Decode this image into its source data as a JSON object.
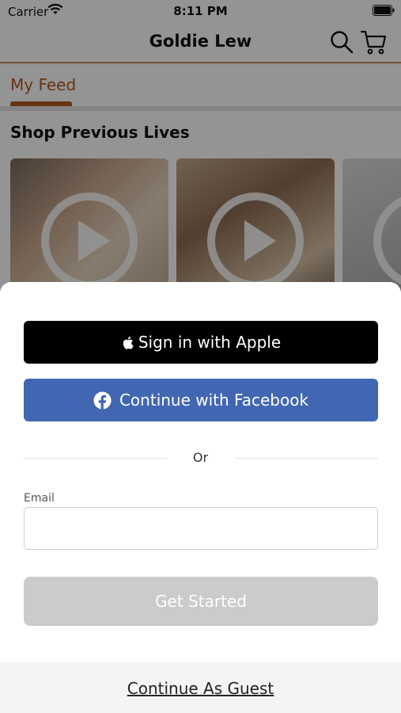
{
  "status_bar": {
    "carrier": "Carrier",
    "time": "8:11 PM"
  },
  "header": {
    "title": "Goldie Lew"
  },
  "tabs": [
    {
      "label": "My Feed",
      "active": true
    }
  ],
  "section": {
    "title": "Shop Previous Lives"
  },
  "colors": {
    "accent": "#b45a22",
    "facebook_blue": "#4267b2",
    "apple_black": "#000000",
    "disabled_gray": "#cbcbcb"
  },
  "login": {
    "apple_label": "Sign in with Apple",
    "facebook_label": "Continue with Facebook",
    "divider_text": "Or",
    "email_label": "Email",
    "email_value": "",
    "email_placeholder": "",
    "submit_label": "Get Started",
    "guest_label": "Continue As Guest"
  },
  "icons": [
    "wifi-icon",
    "battery-icon",
    "search-icon",
    "cart-icon",
    "play-icon",
    "apple-icon",
    "facebook-icon"
  ]
}
